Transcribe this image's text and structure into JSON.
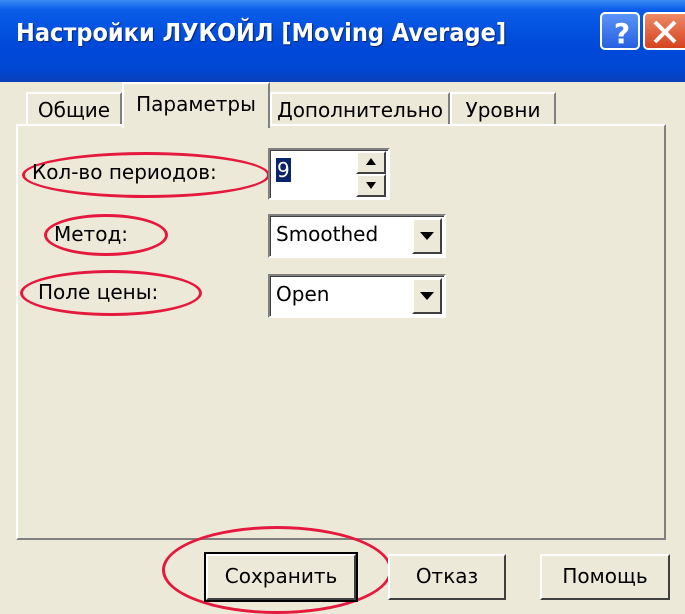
{
  "window": {
    "title": "Настройки ЛУКОЙЛ [Moving Average]",
    "help_icon": "help-icon",
    "close_icon": "close-icon"
  },
  "tabs": [
    {
      "label": "Общие",
      "active": false
    },
    {
      "label": "Параметры",
      "active": true
    },
    {
      "label": "Дополнительно",
      "active": false
    },
    {
      "label": "Уровни",
      "active": false
    }
  ],
  "params": {
    "periods_label": "Кол-во периодов:",
    "periods_value": "9",
    "method_label": "Метод:",
    "method_value": "Smoothed",
    "price_label": "Поле цены:",
    "price_value": "Open"
  },
  "buttons": {
    "save": "Сохранить",
    "cancel": "Отказ",
    "help": "Помощь"
  },
  "colors": {
    "titlebar": "#0A5DE8",
    "highlight_ellipse": "#E5183E",
    "dialog_bg": "#ECE9D8"
  }
}
